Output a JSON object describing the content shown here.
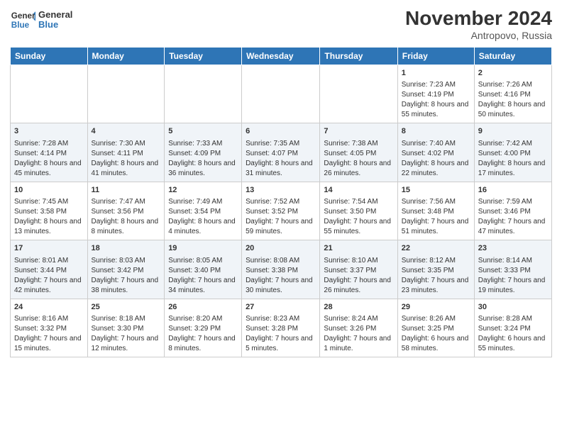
{
  "header": {
    "logo_line1": "General",
    "logo_line2": "Blue",
    "month": "November 2024",
    "location": "Antropovo, Russia"
  },
  "days_of_week": [
    "Sunday",
    "Monday",
    "Tuesday",
    "Wednesday",
    "Thursday",
    "Friday",
    "Saturday"
  ],
  "weeks": [
    [
      {
        "day": "",
        "sunrise": "",
        "sunset": "",
        "daylight": ""
      },
      {
        "day": "",
        "sunrise": "",
        "sunset": "",
        "daylight": ""
      },
      {
        "day": "",
        "sunrise": "",
        "sunset": "",
        "daylight": ""
      },
      {
        "day": "",
        "sunrise": "",
        "sunset": "",
        "daylight": ""
      },
      {
        "day": "",
        "sunrise": "",
        "sunset": "",
        "daylight": ""
      },
      {
        "day": "1",
        "sunrise": "Sunrise: 7:23 AM",
        "sunset": "Sunset: 4:19 PM",
        "daylight": "Daylight: 8 hours and 55 minutes."
      },
      {
        "day": "2",
        "sunrise": "Sunrise: 7:26 AM",
        "sunset": "Sunset: 4:16 PM",
        "daylight": "Daylight: 8 hours and 50 minutes."
      }
    ],
    [
      {
        "day": "3",
        "sunrise": "Sunrise: 7:28 AM",
        "sunset": "Sunset: 4:14 PM",
        "daylight": "Daylight: 8 hours and 45 minutes."
      },
      {
        "day": "4",
        "sunrise": "Sunrise: 7:30 AM",
        "sunset": "Sunset: 4:11 PM",
        "daylight": "Daylight: 8 hours and 41 minutes."
      },
      {
        "day": "5",
        "sunrise": "Sunrise: 7:33 AM",
        "sunset": "Sunset: 4:09 PM",
        "daylight": "Daylight: 8 hours and 36 minutes."
      },
      {
        "day": "6",
        "sunrise": "Sunrise: 7:35 AM",
        "sunset": "Sunset: 4:07 PM",
        "daylight": "Daylight: 8 hours and 31 minutes."
      },
      {
        "day": "7",
        "sunrise": "Sunrise: 7:38 AM",
        "sunset": "Sunset: 4:05 PM",
        "daylight": "Daylight: 8 hours and 26 minutes."
      },
      {
        "day": "8",
        "sunrise": "Sunrise: 7:40 AM",
        "sunset": "Sunset: 4:02 PM",
        "daylight": "Daylight: 8 hours and 22 minutes."
      },
      {
        "day": "9",
        "sunrise": "Sunrise: 7:42 AM",
        "sunset": "Sunset: 4:00 PM",
        "daylight": "Daylight: 8 hours and 17 minutes."
      }
    ],
    [
      {
        "day": "10",
        "sunrise": "Sunrise: 7:45 AM",
        "sunset": "Sunset: 3:58 PM",
        "daylight": "Daylight: 8 hours and 13 minutes."
      },
      {
        "day": "11",
        "sunrise": "Sunrise: 7:47 AM",
        "sunset": "Sunset: 3:56 PM",
        "daylight": "Daylight: 8 hours and 8 minutes."
      },
      {
        "day": "12",
        "sunrise": "Sunrise: 7:49 AM",
        "sunset": "Sunset: 3:54 PM",
        "daylight": "Daylight: 8 hours and 4 minutes."
      },
      {
        "day": "13",
        "sunrise": "Sunrise: 7:52 AM",
        "sunset": "Sunset: 3:52 PM",
        "daylight": "Daylight: 7 hours and 59 minutes."
      },
      {
        "day": "14",
        "sunrise": "Sunrise: 7:54 AM",
        "sunset": "Sunset: 3:50 PM",
        "daylight": "Daylight: 7 hours and 55 minutes."
      },
      {
        "day": "15",
        "sunrise": "Sunrise: 7:56 AM",
        "sunset": "Sunset: 3:48 PM",
        "daylight": "Daylight: 7 hours and 51 minutes."
      },
      {
        "day": "16",
        "sunrise": "Sunrise: 7:59 AM",
        "sunset": "Sunset: 3:46 PM",
        "daylight": "Daylight: 7 hours and 47 minutes."
      }
    ],
    [
      {
        "day": "17",
        "sunrise": "Sunrise: 8:01 AM",
        "sunset": "Sunset: 3:44 PM",
        "daylight": "Daylight: 7 hours and 42 minutes."
      },
      {
        "day": "18",
        "sunrise": "Sunrise: 8:03 AM",
        "sunset": "Sunset: 3:42 PM",
        "daylight": "Daylight: 7 hours and 38 minutes."
      },
      {
        "day": "19",
        "sunrise": "Sunrise: 8:05 AM",
        "sunset": "Sunset: 3:40 PM",
        "daylight": "Daylight: 7 hours and 34 minutes."
      },
      {
        "day": "20",
        "sunrise": "Sunrise: 8:08 AM",
        "sunset": "Sunset: 3:38 PM",
        "daylight": "Daylight: 7 hours and 30 minutes."
      },
      {
        "day": "21",
        "sunrise": "Sunrise: 8:10 AM",
        "sunset": "Sunset: 3:37 PM",
        "daylight": "Daylight: 7 hours and 26 minutes."
      },
      {
        "day": "22",
        "sunrise": "Sunrise: 8:12 AM",
        "sunset": "Sunset: 3:35 PM",
        "daylight": "Daylight: 7 hours and 23 minutes."
      },
      {
        "day": "23",
        "sunrise": "Sunrise: 8:14 AM",
        "sunset": "Sunset: 3:33 PM",
        "daylight": "Daylight: 7 hours and 19 minutes."
      }
    ],
    [
      {
        "day": "24",
        "sunrise": "Sunrise: 8:16 AM",
        "sunset": "Sunset: 3:32 PM",
        "daylight": "Daylight: 7 hours and 15 minutes."
      },
      {
        "day": "25",
        "sunrise": "Sunrise: 8:18 AM",
        "sunset": "Sunset: 3:30 PM",
        "daylight": "Daylight: 7 hours and 12 minutes."
      },
      {
        "day": "26",
        "sunrise": "Sunrise: 8:20 AM",
        "sunset": "Sunset: 3:29 PM",
        "daylight": "Daylight: 7 hours and 8 minutes."
      },
      {
        "day": "27",
        "sunrise": "Sunrise: 8:23 AM",
        "sunset": "Sunset: 3:28 PM",
        "daylight": "Daylight: 7 hours and 5 minutes."
      },
      {
        "day": "28",
        "sunrise": "Sunrise: 8:24 AM",
        "sunset": "Sunset: 3:26 PM",
        "daylight": "Daylight: 7 hours and 1 minute."
      },
      {
        "day": "29",
        "sunrise": "Sunrise: 8:26 AM",
        "sunset": "Sunset: 3:25 PM",
        "daylight": "Daylight: 6 hours and 58 minutes."
      },
      {
        "day": "30",
        "sunrise": "Sunrise: 8:28 AM",
        "sunset": "Sunset: 3:24 PM",
        "daylight": "Daylight: 6 hours and 55 minutes."
      }
    ]
  ]
}
